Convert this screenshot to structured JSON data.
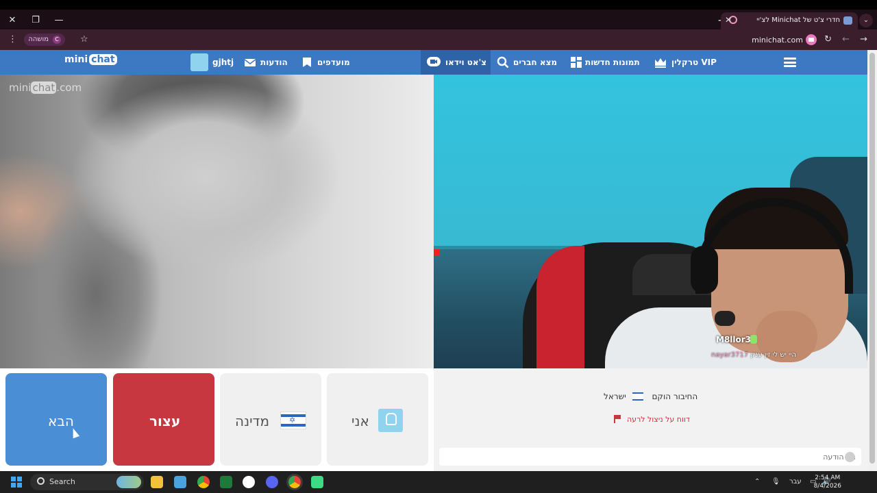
{
  "browser": {
    "tab": {
      "title": "חדרי צ'ט של Minichat לצ'יי",
      "favicon": "chat-bubble-icon"
    },
    "profile": {
      "label": "מושהה",
      "badge": "C"
    },
    "url": "minichat.com"
  },
  "site": {
    "logo": {
      "mini": "mini",
      "chat": "chat"
    },
    "nav": {
      "user": "gjhtj",
      "messages": "הודעות",
      "favorites": "מועדפים",
      "video_chat": "צ'אט וידאו",
      "find_friends": "מצא חברים",
      "new_photos": "תמונות חדשות",
      "vip": "VIP טרקלין"
    },
    "watermark": {
      "mini": "mini",
      "chat": "chat",
      "com": ".com"
    }
  },
  "remote_video": {
    "username": "M8llor3k",
    "caption_user": "nayar3717",
    "caption_text": "היי יש לי זין ענק"
  },
  "controls": {
    "next": "הבא",
    "stop": "עצור",
    "country": "מדינה",
    "me": "אני"
  },
  "chat": {
    "connected": "החיבור הוקם",
    "country": "ישראל",
    "report": "דווח על ניצול לרעה",
    "input_placeholder": "הזן הודעה"
  },
  "taskbar": {
    "search": "Search",
    "language": "עבר",
    "time": "2:54 AM",
    "date": "8/4/2026"
  },
  "colors": {
    "nav_blue": "#3d78c2",
    "next_blue": "#4a8fd6",
    "stop_red": "#c7373f"
  }
}
